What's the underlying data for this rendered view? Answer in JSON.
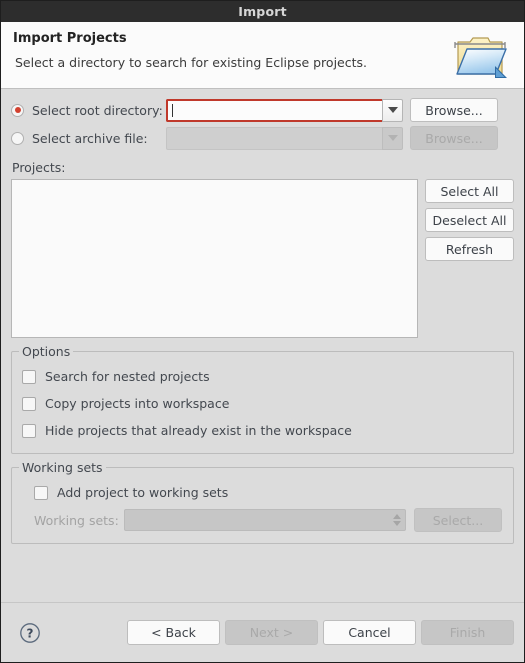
{
  "window": {
    "title": "Import"
  },
  "header": {
    "title": "Import Projects",
    "description": "Select a directory to search for existing Eclipse projects.",
    "icon": "import-folder-icon"
  },
  "source": {
    "root_directory": {
      "radio_label": "Select root directory:",
      "selected": true,
      "value": "",
      "placeholder": "",
      "dropdown_icon": "chevron-down-icon",
      "browse_label": "Browse...",
      "browse_enabled": true,
      "border_color": "#c0392b"
    },
    "archive_file": {
      "radio_label": "Select archive file:",
      "selected": false,
      "value": "",
      "placeholder": "",
      "dropdown_icon": "chevron-down-icon",
      "browse_label": "Browse...",
      "browse_enabled": false
    }
  },
  "projects": {
    "label": "Projects:",
    "items": [],
    "buttons": [
      {
        "label": "Select All",
        "enabled": true
      },
      {
        "label": "Deselect All",
        "enabled": true
      },
      {
        "label": "Refresh",
        "enabled": true
      }
    ]
  },
  "options": {
    "title": "Options",
    "checkboxes": [
      {
        "label": "Search for nested projects",
        "checked": false
      },
      {
        "label": "Copy projects into workspace",
        "checked": false
      },
      {
        "label": "Hide projects that already exist in the workspace",
        "checked": false
      }
    ]
  },
  "working_sets": {
    "title": "Working sets",
    "add_checkbox": {
      "label": "Add project to working sets",
      "checked": false
    },
    "combo_label": "Working sets:",
    "combo_value": "",
    "combo_enabled": false,
    "spinner_icon": "spinner-up-down-icon",
    "select_button": {
      "label": "Select...",
      "enabled": false
    }
  },
  "footer": {
    "help_icon": "help-question-icon",
    "buttons": [
      {
        "label": "< Back",
        "enabled": true
      },
      {
        "label": "Next >",
        "enabled": false
      },
      {
        "label": "Cancel",
        "enabled": true
      },
      {
        "label": "Finish",
        "enabled": false
      }
    ]
  },
  "colors": {
    "titlebar_bg": "#2d2d2d",
    "body_bg": "#dcdcdc",
    "header_bg": "#fbfbfb",
    "accent_error": "#c0392b",
    "radio_dot": "#d2412f",
    "text": "#43484f",
    "disabled_text": "#a9a9a9"
  }
}
